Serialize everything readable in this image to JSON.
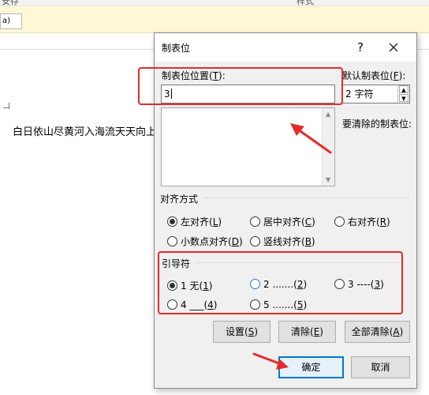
{
  "background": {
    "ribbon_fragment_left": "安存",
    "ribbon_fragment_right": "样式",
    "msgbar_button_label": "a)",
    "document_text": "白日依山尽黄河入海流天天向上"
  },
  "dialog": {
    "title": "制表位",
    "help_label": "?",
    "tab_position_label": "制表位位置(",
    "tab_position_key": "T",
    "tab_position_label_end": "):",
    "tab_position_value": "3",
    "default_tab_label": "默认制表位(",
    "default_tab_key": "F",
    "default_tab_label_end": "):",
    "default_tab_value": "2 字符",
    "clear_label": "要清除的制表位:",
    "alignment": {
      "title": "对齐方式",
      "options": [
        {
          "text": "左对齐(",
          "key": "L",
          "end": ")",
          "checked": true
        },
        {
          "text": "居中对齐(",
          "key": "C",
          "end": ")",
          "checked": false
        },
        {
          "text": "右对齐(",
          "key": "R",
          "end": ")",
          "checked": false
        },
        {
          "text": "小数点对齐(",
          "key": "D",
          "end": ")",
          "checked": false
        },
        {
          "text": "竖线对齐(",
          "key": "B",
          "end": ")",
          "checked": false
        }
      ]
    },
    "leader": {
      "title": "引导符",
      "options": [
        {
          "text": "1 无(",
          "key": "1",
          "end": ")",
          "checked": true
        },
        {
          "text": "2 .......(",
          "key": "2",
          "end": ")",
          "checked": false
        },
        {
          "text": "3 ----(",
          "key": "3",
          "end": ")",
          "checked": false
        },
        {
          "text": "4 ___(",
          "key": "4",
          "end": ")",
          "checked": false
        },
        {
          "text": "5 .......(",
          "key": "5",
          "end": ")",
          "checked": false
        }
      ]
    },
    "buttons": {
      "set": {
        "text": "设置(",
        "key": "S",
        "end": ")"
      },
      "clear": {
        "text": "清除(",
        "key": "E",
        "end": ")"
      },
      "clear_all": {
        "text": "全部清除(",
        "key": "A",
        "end": ")"
      },
      "ok": "确定",
      "cancel": "取消"
    }
  },
  "colors": {
    "annotation_red": "#e52b2b",
    "dialog_bg": "#f0f0f0",
    "focus_blue": "#0078d7"
  }
}
